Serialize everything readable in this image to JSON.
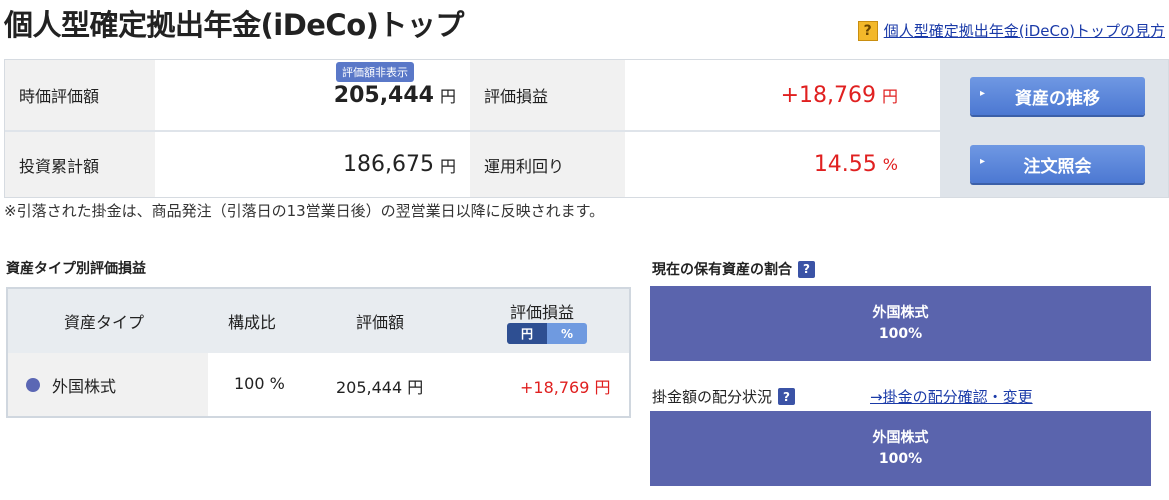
{
  "header": {
    "title": "個人型確定拠出年金(iDeCo)トップ",
    "help_icon_glyph": "?",
    "help_link": "個人型確定拠出年金(iDeCo)トップの見方"
  },
  "summary": {
    "hide_badge": "評価額非表示",
    "market_value_label": "時価評価額",
    "market_value": "205,444",
    "market_value_unit": "円",
    "total_investment_label": "投資累計額",
    "total_investment": "186,675",
    "total_investment_unit": "円",
    "pl_label": "評価損益",
    "pl_value": "+18,769",
    "pl_unit": "円",
    "yield_label": "運用利回り",
    "yield_value": "14.55",
    "yield_unit": "%",
    "btn_asset_history": "資産の推移",
    "btn_order_inquiry": "注文照会",
    "btn_arrow_glyph": "▸"
  },
  "note": "※引落された掛金は、商品発注（引落日の13営業日後）の翌営業日以降に反映されます。",
  "asset_type_section": {
    "title": "資産タイプ別評価損益",
    "headers": {
      "type": "資産タイプ",
      "ratio": "構成比",
      "value": "評価額",
      "pl": "評価損益"
    },
    "toggle": {
      "yen": "円",
      "pct": "%"
    },
    "rows": [
      {
        "type": "外国株式",
        "ratio": "100 %",
        "value": "205,444 円",
        "pl": "+18,769 円"
      }
    ]
  },
  "holdings_section": {
    "title": "現在の保有資産の割合",
    "help_glyph": "?",
    "bar_label": "外国株式",
    "bar_value": "100%"
  },
  "contribution_section": {
    "title": "掛金額の配分状況",
    "help_glyph": "?",
    "link": "→掛金の配分確認・変更",
    "bar_label": "外国株式",
    "bar_value": "100%"
  },
  "colors": {
    "accent_blue": "#4c78d2",
    "profit_red": "#e02020",
    "allocation_purple": "#5a64ad",
    "foreign_stock_dot": "#5b67b4"
  }
}
